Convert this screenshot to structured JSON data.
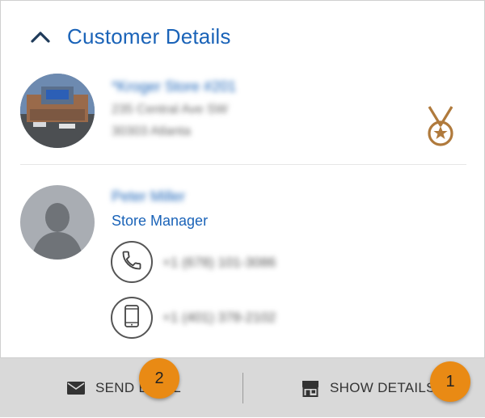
{
  "header": {
    "title": "Customer Details",
    "collapse_icon": "chevron-up-icon"
  },
  "store": {
    "name": "*Kroger Store #201",
    "address_line1": "235 Central Ave SW",
    "address_line2": "30303 Atlanta",
    "badge_icon": "medal-icon",
    "badge_color": "#b07a3c"
  },
  "contact": {
    "name": "Peter Miller",
    "role": "Store Manager",
    "phone": "+1 (678) 101-3086",
    "mobile": "+1 (401) 378-2102",
    "phone_icon": "phone-icon",
    "mobile_icon": "mobile-phone-icon"
  },
  "footer": {
    "send_email_label": "SEND EMAIL",
    "show_details_label": "SHOW DETAILS",
    "send_email_icon": "envelope-icon",
    "show_details_icon": "store-icon"
  },
  "markers": {
    "marker_1": "1",
    "marker_2": "2",
    "color": "#e98a14"
  },
  "colors": {
    "accent": "#1a63b8",
    "footer_bg": "#d9d9d9"
  }
}
